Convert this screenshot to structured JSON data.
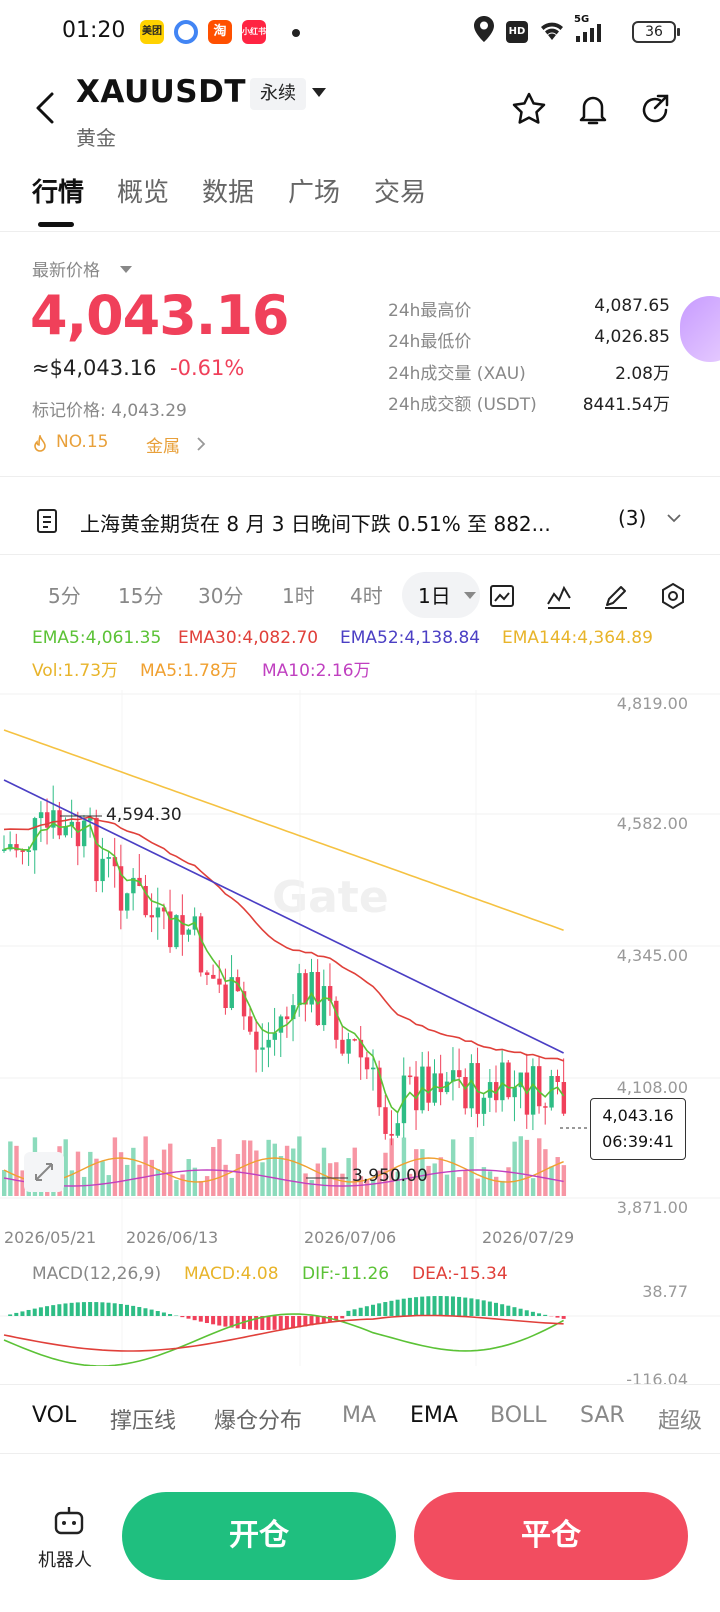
{
  "status_bar": {
    "time": "01:20",
    "battery": "36",
    "app_icons": [
      {
        "label": "美团",
        "color": "#ffd200"
      },
      {
        "label": "",
        "color": "#4285f4"
      },
      {
        "label": "淘",
        "color": "#ff5000"
      },
      {
        "label": "小红书",
        "color": "#ff2442"
      }
    ],
    "network": "5G",
    "hd": "HD"
  },
  "header": {
    "symbol": "XAUUSDT",
    "contract_type": "永续",
    "name": "黄金"
  },
  "tabs": [
    "行情",
    "概览",
    "数据",
    "广场",
    "交易"
  ],
  "price": {
    "label": "最新价格",
    "last": "4,043.16",
    "usd": "≈$4,043.16",
    "change_pct": "-0.61%",
    "mark_price": "标记价格: 4,043.29",
    "rank": "NO.15",
    "category": "金属"
  },
  "stats": [
    {
      "label": "24h最高价",
      "value": "4,087.65"
    },
    {
      "label": "24h最低价",
      "value": "4,026.85"
    },
    {
      "label": "24h成交量 (XAU)",
      "value": "2.08万"
    },
    {
      "label": "24h成交额 (USDT)",
      "value": "8441.54万"
    }
  ],
  "news": {
    "text": "上海黄金期货在 8 月 3 日晚间下跌 0.51% 至 882...",
    "count": "(3)"
  },
  "intervals": [
    "5分",
    "15分",
    "30分",
    "1时",
    "4时"
  ],
  "active_interval": "1日",
  "legend": {
    "ema5": "EMA5:4,061.35",
    "ema30": "EMA30:4,082.70",
    "ema52": "EMA52:4,138.84",
    "ema144": "EMA144:4,364.89",
    "vol": "Vol:1.73万",
    "ma5": "MA5:1.78万",
    "ma10": "MA10:2.16万"
  },
  "colors": {
    "up": "#2ebd85",
    "down": "#f0405a",
    "ema5": "#5bc236",
    "ema30": "#e0403a",
    "ema52": "#4b3fc4",
    "ema144": "#f5c242",
    "ma5_vol": "#f0a030",
    "ma10_vol": "#c040c0"
  },
  "chart": {
    "watermark": "Gate",
    "y_ticks": [
      "4,819.00",
      "4,582.00",
      "4,345.00",
      "4,108.00",
      "3,871.00"
    ],
    "x_ticks": [
      "2026/05/21",
      "2026/06/13",
      "2026/07/06",
      "2026/07/29"
    ],
    "high_marker": "4,594.30",
    "low_marker": "3,950.00",
    "current_price": "4,043.16",
    "countdown": "06:39:41"
  },
  "macd": {
    "title": "MACD(12,26,9)",
    "macd": "MACD:4.08",
    "dif": "DIF:-11.26",
    "dea": "DEA:-15.34",
    "y_top": "38.77",
    "y_bottom": "-116.04"
  },
  "indicator_tabs": [
    "VOL",
    "撑压线",
    "爆仓分布",
    "MA",
    "EMA",
    "BOLL",
    "SAR",
    "超级"
  ],
  "active_indicator": "EMA",
  "bottom": {
    "robot": "机器人",
    "open": "开仓",
    "close": "平仓"
  }
}
